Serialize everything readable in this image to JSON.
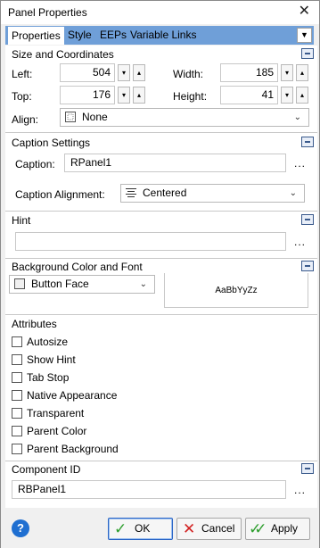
{
  "window": {
    "title": "Panel Properties",
    "close_glyph": "✕"
  },
  "tabs": {
    "items": [
      {
        "label": "Properties"
      },
      {
        "label": "Style"
      },
      {
        "label": "EEPs"
      },
      {
        "label": "Variable Links"
      }
    ],
    "menu_glyph": "▼"
  },
  "size_section": {
    "title": "Size and Coordinates",
    "left_label": "Left:",
    "left_value": "504",
    "top_label": "Top:",
    "top_value": "176",
    "width_label": "Width:",
    "width_value": "185",
    "height_label": "Height:",
    "height_value": "41",
    "align_label": "Align:",
    "align_value": "None"
  },
  "caption_section": {
    "title": "Caption Settings",
    "caption_label": "Caption:",
    "caption_value": "RPanel1",
    "alignment_label": "Caption Alignment:",
    "alignment_value": "Centered"
  },
  "hint_section": {
    "title": "Hint",
    "hint_value": ""
  },
  "bg_section": {
    "title": "Background Color and Font",
    "color_value": "Button Face",
    "font_preview": "AaBbYyZz"
  },
  "attributes": {
    "title": "Attributes",
    "items": [
      {
        "label": "Autosize",
        "checked": false
      },
      {
        "label": "Show Hint",
        "checked": false
      },
      {
        "label": "Tab Stop",
        "checked": false
      },
      {
        "label": "Native Appearance",
        "checked": false
      },
      {
        "label": "Transparent",
        "checked": false
      },
      {
        "label": "Parent Color",
        "checked": false
      },
      {
        "label": "Parent Background",
        "checked": false
      }
    ]
  },
  "component_section": {
    "title": "Component ID",
    "id_value": "RBPanel1"
  },
  "ellipsis": "...",
  "spin": {
    "down": "▾",
    "up": "▴"
  },
  "footer": {
    "help_glyph": "?",
    "ok_label": "OK",
    "cancel_label": "Cancel",
    "apply_label": "Apply"
  },
  "colors": {
    "tab_bar": "#6f9fd8",
    "ok_check": "#2e9e2e",
    "cancel_x": "#d22222",
    "help": "#1f6fd1"
  },
  "icons": {
    "close": "close-icon",
    "tab_menu": "dropdown-arrow-icon",
    "collapse": "collapse-icon",
    "align_none": "align-none-icon",
    "caption_align": "align-center-icon",
    "help": "help-icon",
    "ok": "checkmark-icon",
    "cancel": "x-icon",
    "apply": "double-check-icon"
  }
}
